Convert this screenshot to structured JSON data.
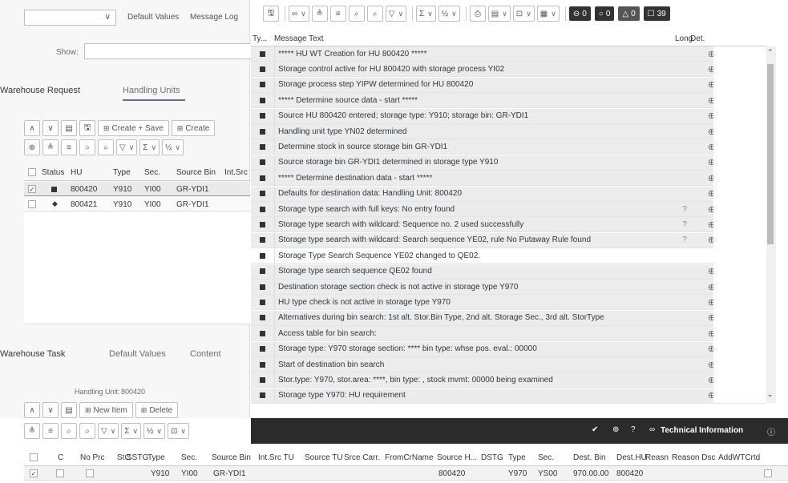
{
  "left": {
    "default_values": "Default Values",
    "message_log": "Message Log",
    "show_label": "Show:",
    "tabs": {
      "warehouse_request": "Warehouse Request",
      "handling_units": "Handling Units"
    },
    "toolbar": {
      "create_save": "Create + Save",
      "create": "Create"
    },
    "hu_table": {
      "headers": [
        "Status",
        "HU",
        "Type",
        "Sec.",
        "Source Bin",
        "Int.Src"
      ],
      "rows": [
        {
          "hu": "800420",
          "type": "Y910",
          "sec": "YI00",
          "bin": "GR-YDI1"
        },
        {
          "hu": "800421",
          "type": "Y910",
          "sec": "YI00",
          "bin": "GR-YDI1"
        }
      ]
    },
    "tabs2": {
      "warehouse_task": "Warehouse Task",
      "default_values": "Default Values",
      "content": "Content"
    },
    "handling_unit_label": "Handling Unit:",
    "handling_unit_value": "800420",
    "toolbar2": {
      "new_item": "New Item",
      "delete": "Delete"
    }
  },
  "log": {
    "headers": {
      "ty": "Ty...",
      "text": "Message Text",
      "long": "Long",
      "det": "Det."
    },
    "badges": {
      "error": "0",
      "warning_circle": "0",
      "warning": "0",
      "total": "39"
    },
    "messages": [
      "***** HU WT Creation for HU 800420 *****",
      "Storage control active for HU 800420 with storage process YI02",
      "Storage process step YIPW determined for HU 800420",
      "***** Determine source data - start *****",
      "Source HU 800420 entered; storage type: Y910; storage bin: GR-YDI1",
      "Handling unit type YN02 determined",
      "Determine stock in source storage bin GR-YDI1",
      "Source storage bin GR-YDI1 determined in storage type Y910",
      "***** Determine destination data - start *****",
      "Defaults for destination data: Handling Unit: 800420",
      "Storage type search with full keys: No entry found",
      "Storage type search with wildcard: Sequence no. 2 used successfully",
      "Storage type search with wildcard: Search sequence YE02, rule No Putaway Rule found",
      "Storage Type Search Sequence YE02 changed to QE02.",
      "Storage type search sequence QE02 found",
      "Destination storage section check is not active in storage type Y970",
      "HU type check is not active in storage type Y970",
      "Alternatives during bin search: 1st alt. Stor.Bin Type, 2nd alt. Storage Sec., 3rd alt. StorType",
      "Access table for bin search:",
      "Storage type: Y970 storage section: **** bin type: whse pos. eval.: 00000",
      "Start of destination bin search",
      "Stor.type: Y970, stor.area: ****, bin type: , stock mvmt: 00000 being examined",
      "Storage type Y970: HU requirement"
    ]
  },
  "footer": {
    "technical_information": "Technical Information"
  },
  "task_table": {
    "headers": [
      "C",
      "No Prc",
      "StC",
      "SSTG",
      "Type",
      "Sec.",
      "Source Bin",
      "Int.Src TU",
      "Source TU",
      "Srce Carr.",
      "FromCrName",
      "Source H...",
      "DSTG",
      "Type",
      "Sec.",
      "Dest. Bin",
      "Dest.HU",
      "Reasn",
      "Reason Dsc",
      "AddWTCrtd"
    ],
    "row": {
      "type": "Y910",
      "sec": "YI00",
      "source_bin": "GR-YDI1",
      "source_hu": "800420",
      "dtype": "Y970",
      "dsec": "YS00",
      "dest_bin": "970.00.00",
      "dest_hu": "800420"
    }
  }
}
